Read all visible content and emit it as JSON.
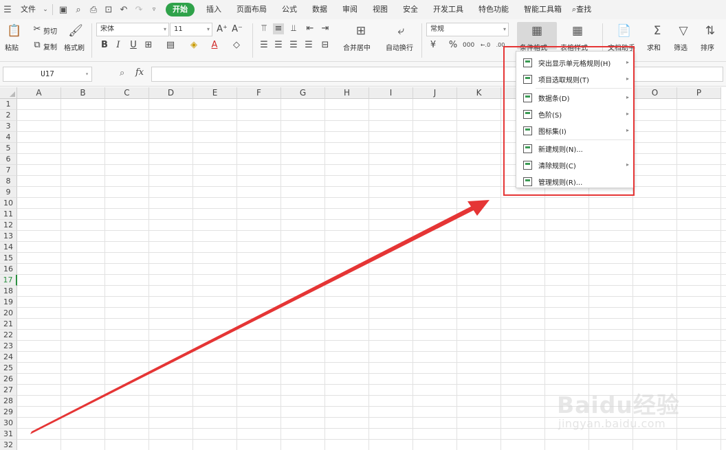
{
  "menubar": {
    "file_label": "文件",
    "tabs": [
      "开始",
      "插入",
      "页面布局",
      "公式",
      "数据",
      "审阅",
      "视图",
      "安全",
      "开发工具",
      "特色功能",
      "智能工具箱"
    ],
    "active_tab": "开始",
    "search_label": "查找"
  },
  "ribbon": {
    "paste_label": "粘贴",
    "cut_label": "剪切",
    "copy_label": "复制",
    "format_painter_label": "格式刷",
    "font_name": "宋体",
    "font_size": "11",
    "bold_label": "B",
    "italic_label": "I",
    "underline_label": "U",
    "merge_center_label": "合并居中",
    "wrap_text_label": "自动换行",
    "number_format": "常规",
    "percent_label": "%",
    "conditional_format_label": "条件格式",
    "table_style_label": "表格样式",
    "doc_assistant_label": "文档助手",
    "sum_label": "求和",
    "filter_label": "筛选",
    "sort_label": "排序"
  },
  "formula_bar": {
    "cell_ref": "U17",
    "fx_label": "fx",
    "formula_value": ""
  },
  "grid": {
    "columns": [
      "A",
      "B",
      "C",
      "D",
      "E",
      "F",
      "G",
      "H",
      "I",
      "J",
      "K",
      "L",
      "M",
      "N",
      "O",
      "P"
    ],
    "rows": [
      "1",
      "2",
      "3",
      "4",
      "5",
      "6",
      "7",
      "8",
      "9",
      "10",
      "11",
      "12",
      "13",
      "14",
      "15",
      "16",
      "17",
      "18",
      "19",
      "20",
      "21",
      "22",
      "23",
      "24",
      "25",
      "26",
      "27",
      "28",
      "29",
      "30",
      "31",
      "32"
    ],
    "selected_row": "17"
  },
  "conditional_menu": {
    "items": [
      {
        "label": "突出显示单元格规则(H)",
        "has_submenu": true,
        "icon": "highlight-rules-icon"
      },
      {
        "label": "项目选取规则(T)",
        "has_submenu": true,
        "icon": "top-bottom-rules-icon"
      },
      {
        "label": "数据条(D)",
        "has_submenu": true,
        "icon": "data-bars-icon"
      },
      {
        "label": "色阶(S)",
        "has_submenu": true,
        "icon": "color-scales-icon"
      },
      {
        "label": "图标集(I)",
        "has_submenu": true,
        "icon": "icon-sets-icon"
      },
      {
        "label": "新建规则(N)...",
        "has_submenu": false,
        "icon": "new-rule-icon"
      },
      {
        "label": "清除规则(C)",
        "has_submenu": true,
        "icon": "clear-rules-icon"
      },
      {
        "label": "管理规则(R)...",
        "has_submenu": false,
        "icon": "manage-rules-icon"
      }
    ]
  },
  "watermark": {
    "brand": "Baidu经验",
    "url": "jingyan.baidu.com"
  },
  "colors": {
    "accent_green": "#2fa24a",
    "highlight_red": "#e53535"
  }
}
